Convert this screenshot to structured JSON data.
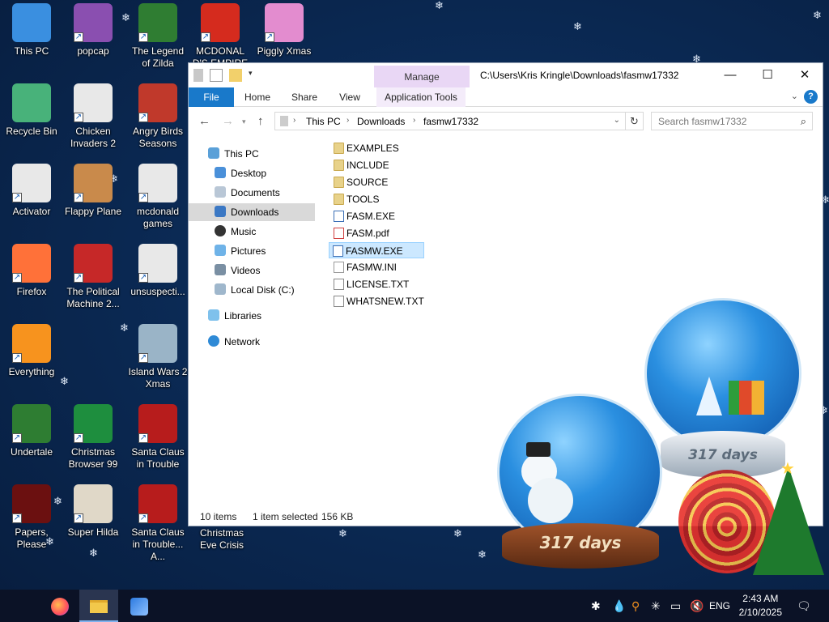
{
  "desktop": {
    "icons": [
      {
        "label": "This PC",
        "icon": "computer-icon",
        "color": "#3a8fe0"
      },
      {
        "label": "popcap",
        "icon": "popcap-icon",
        "color": "#8a4fb0"
      },
      {
        "label": "The Legend of Zilda",
        "icon": "zelda-game-icon",
        "color": "#2f7d32"
      },
      {
        "label": "MCDONAL D'S EMPIRE",
        "icon": "mcdonalds-icon",
        "color": "#d52b1e"
      },
      {
        "label": "Piggly Xmas",
        "icon": "piggy-icon",
        "color": "#e38ccf"
      },
      {
        "label": "Recycle Bin",
        "icon": "recycle-bin-icon",
        "color": "#48b27a"
      },
      {
        "label": "Chicken Invaders 2",
        "icon": "chicken-icon",
        "color": "#e8e8e8"
      },
      {
        "label": "Angry Birds Seasons",
        "icon": "angry-birds-icon",
        "color": "#c0392b"
      },
      {
        "label": "Activator",
        "icon": "document-icon",
        "color": "#e8e8e8"
      },
      {
        "label": "Flappy Plane",
        "icon": "flappy-plane-icon",
        "color": "#c98a4b"
      },
      {
        "label": "mcdonald games",
        "icon": "folder-doc-icon",
        "color": "#e8e8e8"
      },
      {
        "label": "Firefox",
        "icon": "firefox-icon",
        "color": "#ff7139"
      },
      {
        "label": "The Political Machine 2...",
        "icon": "political-machine-icon",
        "color": "#c62828"
      },
      {
        "label": "unsuspecti...",
        "icon": "document-icon",
        "color": "#e8e8e8"
      },
      {
        "label": "Everything",
        "icon": "everything-search-icon",
        "color": "#f7931e"
      },
      {
        "label": "Island Wars 2 Xmas",
        "icon": "island-wars-icon",
        "color": "#9ab4c7"
      },
      {
        "label": "Undertale",
        "icon": "undertale-icon",
        "color": "#2e7d32"
      },
      {
        "label": "Christmas Browser 99",
        "icon": "christmas-tree-icon",
        "color": "#1e8e3e"
      },
      {
        "label": "Santa Claus in Trouble",
        "icon": "santa-icon",
        "color": "#b71c1c"
      },
      {
        "label": "Papers, Please",
        "icon": "papers-please-icon",
        "color": "#6b1010"
      },
      {
        "label": "Super Hilda",
        "icon": "super-hilda-icon",
        "color": "#e0d8c8"
      },
      {
        "label": "Santa Claus in Trouble... A...",
        "icon": "santa-icon",
        "color": "#b71c1c"
      },
      {
        "label": "Christmas Eve Crisis",
        "icon": "",
        "color": ""
      }
    ]
  },
  "explorer": {
    "title_path": "C:\\Users\\Kris Kringle\\Downloads\\fasmw17332",
    "manage_tab": "Manage",
    "ribbon_tabs": {
      "file": "File",
      "home": "Home",
      "share": "Share",
      "view": "View",
      "app_tools": "Application Tools"
    },
    "help": "?",
    "breadcrumb": {
      "this_pc": "This PC",
      "downloads": "Downloads",
      "folder": "fasmw17332"
    },
    "search_placeholder": "Search fasmw17332",
    "nav": {
      "this_pc": "This PC",
      "desktop": "Desktop",
      "documents": "Documents",
      "downloads": "Downloads",
      "music": "Music",
      "pictures": "Pictures",
      "videos": "Videos",
      "local_disk": "Local Disk (C:)",
      "libraries": "Libraries",
      "network": "Network"
    },
    "files": [
      {
        "name": "EXAMPLES",
        "type": "folder"
      },
      {
        "name": "INCLUDE",
        "type": "folder"
      },
      {
        "name": "SOURCE",
        "type": "folder"
      },
      {
        "name": "TOOLS",
        "type": "folder"
      },
      {
        "name": "FASM.EXE",
        "type": "exe"
      },
      {
        "name": "FASM.pdf",
        "type": "pdf"
      },
      {
        "name": "FASMW.EXE",
        "type": "exe"
      },
      {
        "name": "FASMW.INI",
        "type": "ini"
      },
      {
        "name": "LICENSE.TXT",
        "type": "txt"
      },
      {
        "name": "WHATSNEW.TXT",
        "type": "txt"
      }
    ],
    "status": {
      "count": "10 items",
      "selected": "1 item selected",
      "size": "156 KB"
    }
  },
  "widgets": {
    "globe_left_days": "317 days",
    "globe_right_days": "317 days"
  },
  "taskbar": {
    "language": "ENG",
    "time": "2:43 AM",
    "date": "2/10/2025"
  },
  "colors": {
    "accent": "#1979ca",
    "manage_tab": "#e9d7f5",
    "selection": "#cce8ff",
    "desktop_bg": "#0b2a55",
    "taskbar_bg": "#0b1226"
  }
}
